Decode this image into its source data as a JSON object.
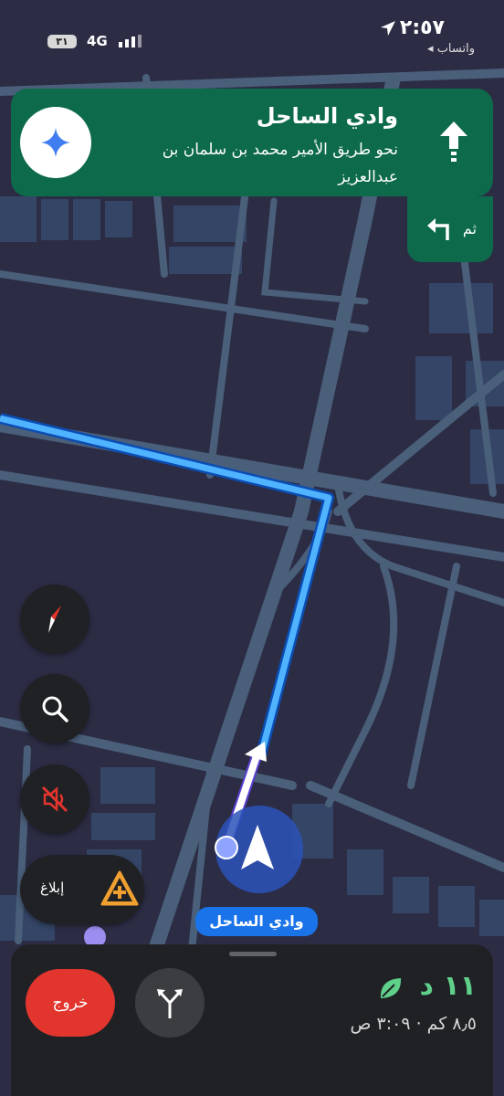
{
  "status_bar": {
    "time": "٢:٥٧",
    "back_app": "◂ واتساب",
    "network": "4G",
    "battery": "٣١"
  },
  "guidance": {
    "street": "وادي الساحل",
    "toward": "نحو طريق الأمير محمد بن سلمان بن عبدالعزيز",
    "then_label": "ثم"
  },
  "map": {
    "current_street_label": "وادي الساحل",
    "route_color": "#4fb3ff",
    "road_color": "#4a5f7a"
  },
  "controls": {
    "report_label": "إبلاغ"
  },
  "trip": {
    "exit_label": "خروج",
    "duration": "١١ د",
    "distance_arrival": "٨٫٥ كم · ٣:٠٩ ص"
  },
  "colors": {
    "banner_green": "#0d6a4b",
    "exit_red": "#e2352e",
    "eta_green": "#5fd08a",
    "nav_blue": "#1a73e8"
  }
}
